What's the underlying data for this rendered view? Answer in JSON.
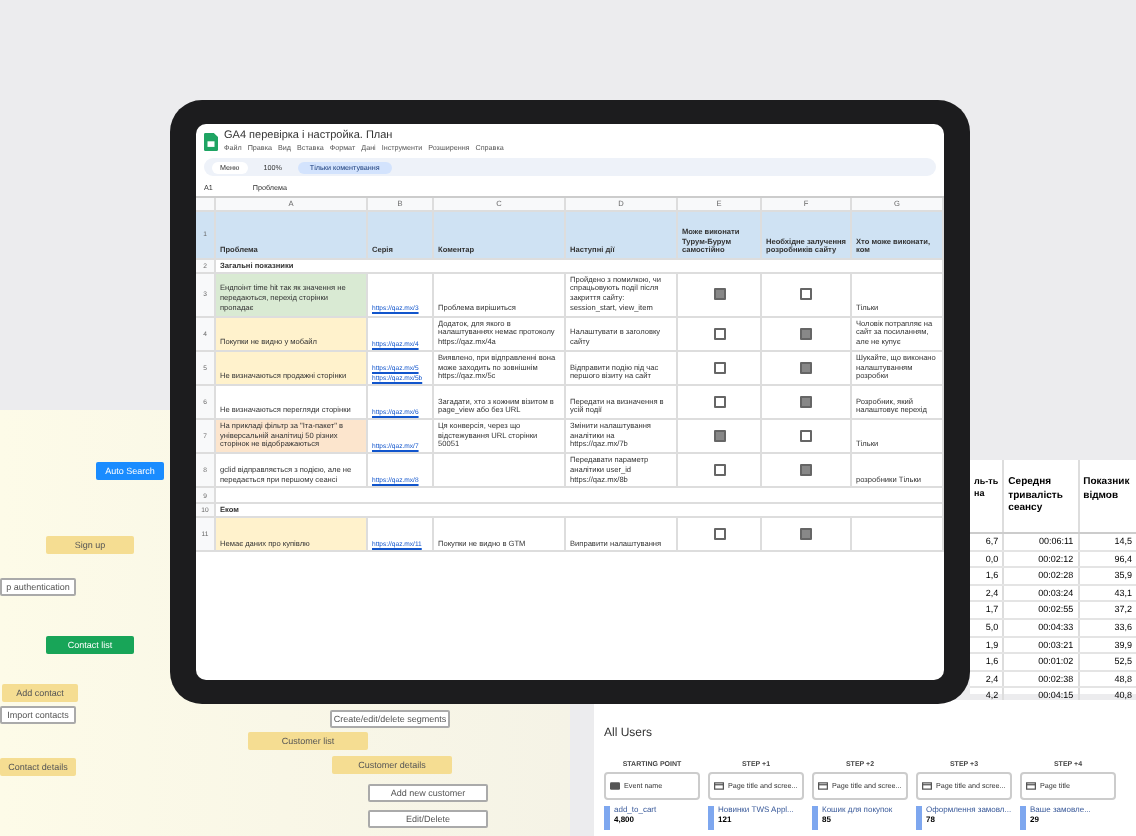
{
  "flowchart": {
    "nodes": [
      {
        "label": "Auto Search",
        "kind": "primary"
      },
      {
        "label": "Sign up",
        "kind": "yellow"
      },
      {
        "label": "p authentication",
        "kind": "plain"
      },
      {
        "label": "Contact list",
        "kind": "green"
      },
      {
        "label": "Add contact",
        "kind": "yellow"
      },
      {
        "label": "Import contacts",
        "kind": "plain"
      },
      {
        "label": "Contact details",
        "kind": "yellow"
      },
      {
        "label": "Create/edit/delete segments",
        "kind": "plain"
      },
      {
        "label": "Customer list",
        "kind": "yellow"
      },
      {
        "label": "Customer details",
        "kind": "yellow"
      },
      {
        "label": "Add new customer",
        "kind": "plain"
      },
      {
        "label": "Edit/Delete",
        "kind": "plain"
      }
    ]
  },
  "report": {
    "columns": [
      "ль-ть на",
      "Середня тривалість сеансу",
      "Показник відмов"
    ],
    "rows": [
      [
        "6,7",
        "00:06:11",
        "14,5"
      ],
      [
        "0,0",
        "00:02:12",
        "96,4"
      ],
      [
        "1,6",
        "00:02:28",
        "35,9"
      ],
      [
        "2,4",
        "00:03:24",
        "43,1"
      ],
      [
        "1,7",
        "00:02:55",
        "37,2"
      ],
      [
        "5,0",
        "00:04:33",
        "33,6"
      ],
      [
        "1,9",
        "00:03:21",
        "39,9"
      ],
      [
        "1,6",
        "00:01:02",
        "52,5"
      ],
      [
        "2,4",
        "00:02:38",
        "48,8"
      ],
      [
        "4,2",
        "00:04:15",
        "40,8"
      ]
    ]
  },
  "exploration": {
    "title": "All Users",
    "steps": [
      {
        "label": "STARTING POINT",
        "field": "Event name",
        "value": "add_to_cart",
        "count": "4,800",
        "kind": "event"
      },
      {
        "label": "STEP +1",
        "field": "Page title and scree...",
        "value": "Новинки TWS Appl...",
        "count": "121",
        "kind": "page"
      },
      {
        "label": "STEP +2",
        "field": "Page title and scree...",
        "value": "Кошик для покупок",
        "count": "85",
        "kind": "page"
      },
      {
        "label": "STEP +3",
        "field": "Page title and scree...",
        "value": "Оформлення замовл...",
        "count": "78",
        "kind": "page"
      },
      {
        "label": "STEP +4",
        "field": "Page title",
        "value": "Ваше замовле...",
        "count": "29",
        "kind": "page"
      }
    ]
  },
  "sheet": {
    "title": "GA4 перевірка і настройка. План",
    "menu": [
      "Файл",
      "Правка",
      "Вид",
      "Вставка",
      "Формат",
      "Дані",
      "Інструменти",
      "Розширення",
      "Справка"
    ],
    "search": "Меню",
    "zoom": "100%",
    "mode": "Тільки коментування",
    "cell_ref": "A1",
    "formula": "Проблема",
    "columns": [
      "A",
      "B",
      "C",
      "D",
      "E",
      "F",
      "G"
    ],
    "header_num": "1",
    "header": [
      "Проблема",
      "Серія",
      "Коментар",
      "Наступні дії",
      "Може виконати Турум-Бурум самостійно",
      "Необхідне залучення розробників сайту",
      "Хто може виконати, ком"
    ],
    "rows": [
      {
        "num": "2",
        "kind": "section",
        "problem": "Загальні показники"
      },
      {
        "num": "3",
        "kind": "item",
        "color": "#d9ead3",
        "problem": "Ендпоінт time hit так як значення не передаються, перехід сторінки пропадає",
        "series": [
          "https://qaz.mx/3"
        ],
        "comment": "Проблема вирішиться",
        "next": "Пройдено з помилкою, чи спрацьовують події після закриття сайту: session_start, view_item",
        "can_self": true,
        "needs_dev": false,
        "who": "Тільки"
      },
      {
        "num": "4",
        "kind": "item",
        "color": "#fff2cc",
        "problem": "Покупки не видно у мобайл",
        "series": [
          "https://qaz.mx/4"
        ],
        "comment": "Додаток, для якого в налаштуваннях немає протоколу https://qaz.mx/4a",
        "next": "Налаштувати в заголовку сайту",
        "can_self": false,
        "needs_dev": true,
        "who": "Чоловік потрапляє на сайт за посиланням, але не купує"
      },
      {
        "num": "5",
        "kind": "item",
        "color": "#fff2cc",
        "problem": "Не визначаються продажні сторінки",
        "series": [
          "https://qaz.mx/5",
          "https://qaz.mx/5b"
        ],
        "comment": "Виявлено, при відправленні вона може заходить по зовнішнім https://qaz.mx/5c",
        "next": "Відправити подію під час першого візиту на сайт",
        "can_self": false,
        "needs_dev": true,
        "who": "Шукайте, що виконано налаштуванням розробки"
      },
      {
        "num": "6",
        "kind": "item",
        "color": "#ffffff",
        "problem": "Не визначаються перегляди сторінки",
        "series": [
          "https://qaz.mx/6"
        ],
        "comment": "Загадати, хто з кожним візитом в page_view або без URL",
        "next": "Передати на визначення в усій події",
        "can_self": false,
        "needs_dev": true,
        "who": "Розробник, який налаштовує перехід"
      },
      {
        "num": "7",
        "kind": "item",
        "color": "#fce5cd",
        "problem": "На прикладі фільтр за \"Іта-пакет\" в універсальній аналітиці 50 різних сторінок не відображаються",
        "series": [
          "https://qaz.mx/7"
        ],
        "comment": "Ця конверсія, через що відстежування URL сторінки 50051",
        "next": "Змінити налаштування аналітики на https://qaz.mx/7b",
        "can_self": true,
        "needs_dev": false,
        "who": "Тільки"
      },
      {
        "num": "8",
        "kind": "item",
        "color": "#ffffff",
        "problem": "gclid відправляється з подією, але не передається при першому сеансі",
        "series": [
          "https://qaz.mx/8"
        ],
        "comment": "",
        "next": "Передавати параметр аналітики user_id https://qaz.mx/8b",
        "can_self": false,
        "needs_dev": true,
        "who": "розробники Тільки"
      },
      {
        "num": "9",
        "kind": "empty"
      },
      {
        "num": "10",
        "kind": "section",
        "problem": "Еком"
      },
      {
        "num": "11",
        "kind": "item",
        "color": "#fff2cc",
        "problem": "Немає даних про купівлю",
        "series": [
          "https://qaz.mx/11"
        ],
        "comment": "Покупки не видно в GTM",
        "next": "Виправити налаштування",
        "can_self": false,
        "needs_dev": true,
        "who": ""
      }
    ]
  }
}
